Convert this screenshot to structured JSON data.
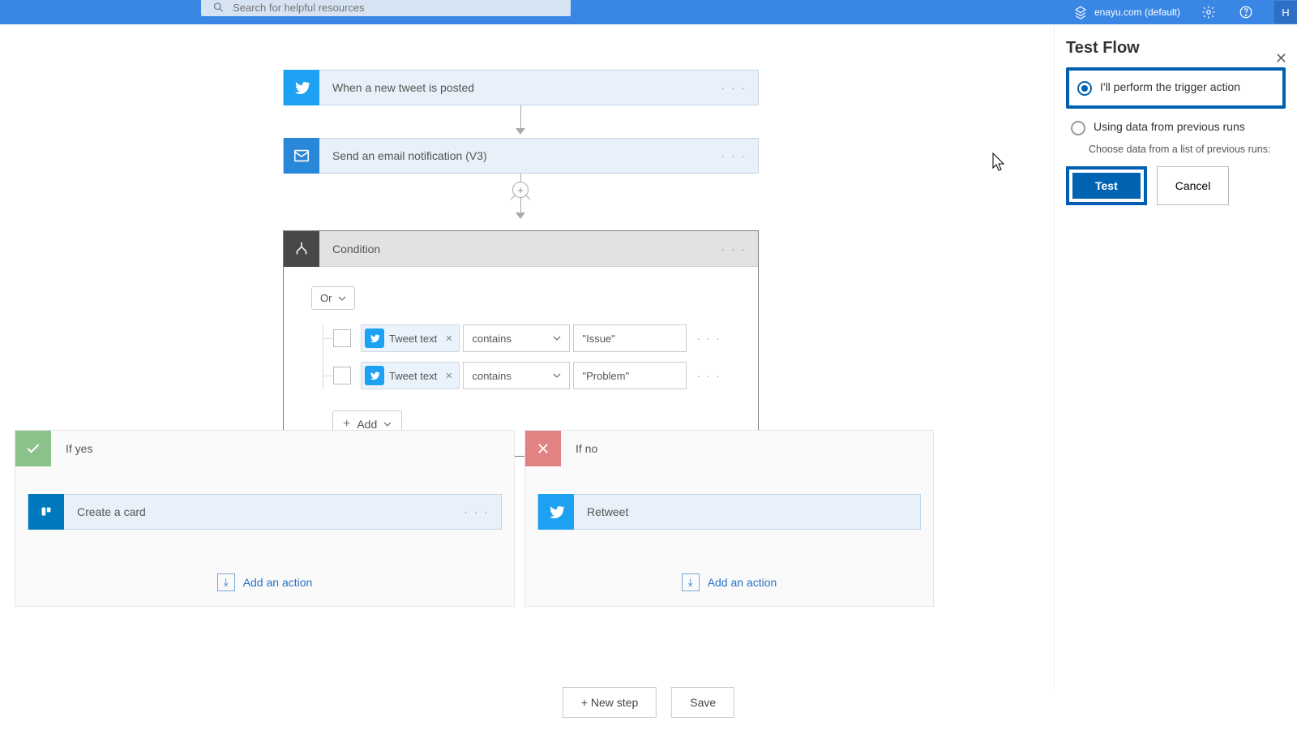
{
  "header": {
    "search_placeholder": "Search for helpful resources",
    "environment_label": "enayu.com (default)",
    "avatar_initial": "H"
  },
  "flow": {
    "trigger": {
      "title": "When a new tweet is posted"
    },
    "action1": {
      "title": "Send an email notification (V3)"
    },
    "condition": {
      "title": "Condition",
      "group_operator": "Or",
      "rows": [
        {
          "token": "Tweet text",
          "operator": "contains",
          "value": "\"Issue\""
        },
        {
          "token": "Tweet text",
          "operator": "contains",
          "value": "\"Problem\""
        }
      ],
      "add_label": "Add"
    },
    "branches": {
      "yes": {
        "title": "If yes",
        "card_title": "Create a card",
        "add_action_label": "Add an action"
      },
      "no": {
        "title": "If no",
        "card_title": "Retweet",
        "add_action_label": "Add an action"
      }
    },
    "bottom": {
      "new_step": "+ New step",
      "save": "Save"
    }
  },
  "panel": {
    "title": "Test Flow",
    "option1_label": "I'll perform the trigger action",
    "option2_label": "Using data from previous runs",
    "option2_sub": "Choose data from a list of previous runs:",
    "test_btn": "Test",
    "cancel_btn": "Cancel"
  }
}
